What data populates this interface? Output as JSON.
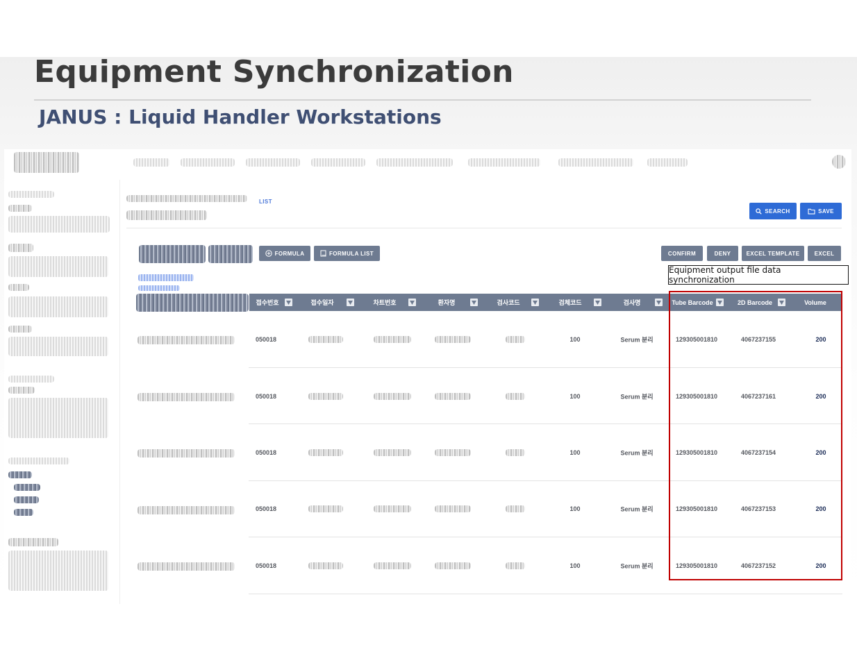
{
  "slide": {
    "title": "Equipment Synchronization",
    "subtitle": "JANUS : Liquid Handler Workstations"
  },
  "app": {
    "breadcrumb_current": "LIST",
    "search_label": "SEARCH",
    "save_label": "SAVE",
    "toolbar": {
      "formula_label": "FORMULA",
      "formula_list_label": "FORMULA LIST",
      "confirm_label": "CONFIRM",
      "deny_label": "DENY",
      "excel_template_label": "EXCEL TEMPLATE",
      "excel_label": "EXCEL"
    },
    "columns": [
      "접수번호",
      "접수일자",
      "차트번호",
      "환자명",
      "검사코드",
      "검체코드",
      "검사명",
      "Tube Barcode",
      "2D Barcode",
      "Volume"
    ],
    "rows": [
      {
        "receipt_no": "050018",
        "specimen_code": "100",
        "test_name": "Serum 분리",
        "tube_barcode": "129305001810",
        "barcode_2d": "4067237155",
        "volume": "200"
      },
      {
        "receipt_no": "050018",
        "specimen_code": "100",
        "test_name": "Serum 분리",
        "tube_barcode": "129305001810",
        "barcode_2d": "4067237161",
        "volume": "200"
      },
      {
        "receipt_no": "050018",
        "specimen_code": "100",
        "test_name": "Serum 분리",
        "tube_barcode": "129305001810",
        "barcode_2d": "4067237154",
        "volume": "200"
      },
      {
        "receipt_no": "050018",
        "specimen_code": "100",
        "test_name": "Serum 분리",
        "tube_barcode": "129305001810",
        "barcode_2d": "4067237153",
        "volume": "200"
      },
      {
        "receipt_no": "050018",
        "specimen_code": "100",
        "test_name": "Serum 분리",
        "tube_barcode": "129305001810",
        "barcode_2d": "4067237152",
        "volume": "200"
      }
    ]
  },
  "callout": {
    "text": "Equipment output file data synchronization"
  },
  "colors": {
    "primary": "#2e6bd6",
    "header": "#6e7b91",
    "highlight": "#c00000",
    "subtitle": "#3f4f73"
  }
}
